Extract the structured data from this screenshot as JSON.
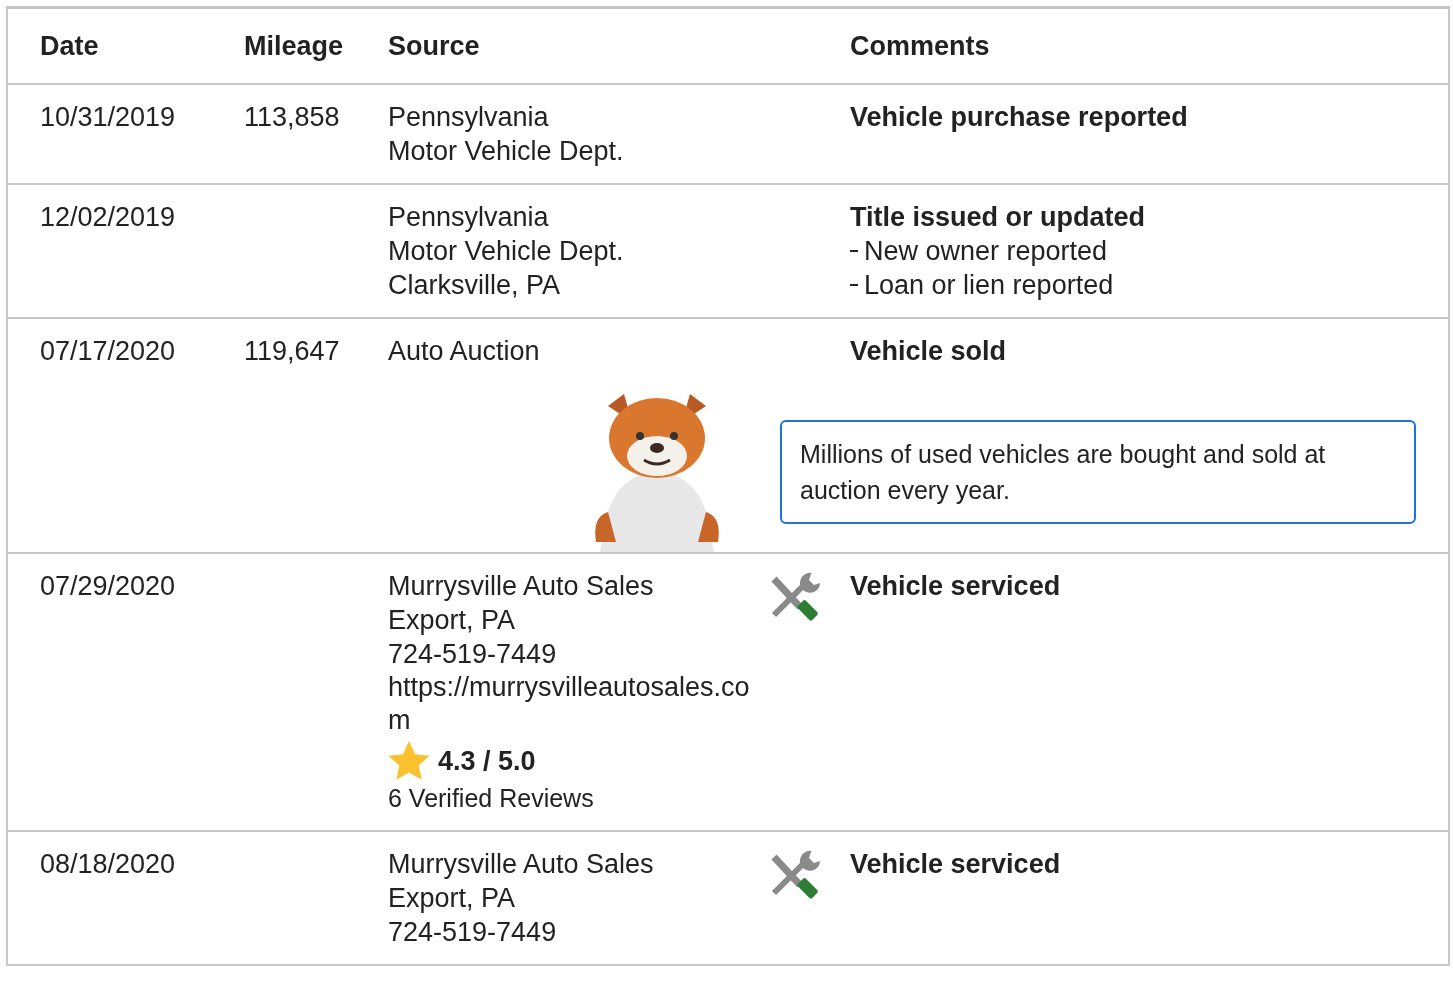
{
  "table": {
    "columns": [
      "Date",
      "Mileage",
      "Source",
      "Comments"
    ],
    "rows": [
      {
        "date": "10/31/2019",
        "mileage": "113,858",
        "source": [
          "Pennsylvania",
          "Motor Vehicle Dept."
        ],
        "comments": [
          {
            "text": "Vehicle purchase reported",
            "kind": "title"
          }
        ]
      },
      {
        "date": "12/02/2019",
        "source": [
          "Pennsylvania",
          "Motor Vehicle Dept.",
          "Clarksville, PA"
        ],
        "comments": [
          {
            "text": "Title issued or updated",
            "kind": "title"
          },
          {
            "text": "New owner reported",
            "kind": "detail"
          },
          {
            "text": "Loan or lien reported",
            "kind": "detail"
          }
        ]
      },
      {
        "date": "07/17/2020",
        "mileage": "119,647",
        "source": [
          "Auto Auction"
        ],
        "comments": [
          {
            "text": "Vehicle sold",
            "kind": "title"
          }
        ],
        "note": "Millions of used vehicles are bought and sold at auction every year."
      },
      {
        "date": "07/29/2020",
        "source": [
          "Murrysville Auto Sales",
          "Export, PA",
          "724-519-7449",
          "https://murrysvilleautosales.com"
        ],
        "rating": "4.3 / 5.0",
        "reviews": "6 Verified Reviews",
        "kind": "service",
        "comments": [
          {
            "text": "Vehicle serviced",
            "kind": "title"
          }
        ]
      },
      {
        "date": "08/18/2020",
        "source": [
          "Murrysville Auto Sales",
          "Export, PA",
          "724-519-7449"
        ],
        "kind": "service",
        "comments": [
          {
            "text": "Vehicle serviced",
            "kind": "title"
          }
        ]
      }
    ]
  }
}
